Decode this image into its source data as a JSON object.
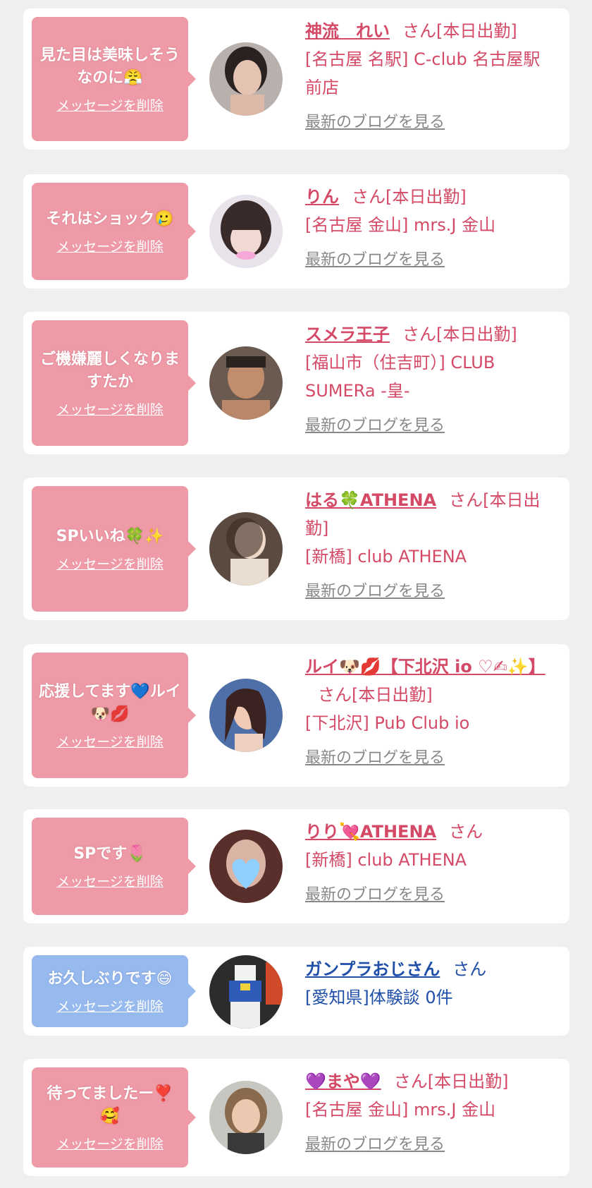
{
  "delete_label": "メッセージを削除",
  "blog_label": "最新のブログを見る",
  "colors": {
    "pink_bubble": "#ee9aa7",
    "blue_bubble": "#96b9ee",
    "pink_text": "#d44a66",
    "blue_text": "#1f4fa8",
    "link_gray": "#888888"
  },
  "entries": [
    {
      "message": "見た目は美味しそうなのに😤",
      "name": "神流　れい",
      "suffix": "さん[本日出勤]",
      "shop": "[名古屋 名駅] C-club 名古屋駅前店",
      "avatar_icon": "woman-portrait-avatar",
      "theme": "pink"
    },
    {
      "message": "それはショック🥲",
      "name": "りん",
      "suffix": "さん[本日出勤]",
      "shop": "[名古屋 金山] mrs.J 金山",
      "avatar_icon": "woman-portrait-avatar",
      "theme": "pink"
    },
    {
      "message": "ご機嫌麗しくなりますたか",
      "name": "スメラ王子",
      "suffix": "さん[本日出勤]",
      "shop": "[福山市（住吉町）] CLUB SUMERa -皇-",
      "avatar_icon": "man-portrait-avatar",
      "theme": "pink"
    },
    {
      "message": "SPいいね🍀✨",
      "name": "はる🍀ATHENA",
      "suffix": "さん[本日出勤]",
      "shop": "[新橋] club ATHENA",
      "avatar_icon": "woman-portrait-avatar",
      "theme": "pink"
    },
    {
      "message": "応援してます💙ルイ🐶💋",
      "name": "ルイ🐶💋【下北沢 io ♡✍✨】",
      "suffix": "さん[本日出勤]",
      "shop": "[下北沢] Pub Club io",
      "avatar_icon": "woman-portrait-avatar",
      "theme": "pink"
    },
    {
      "message": "SPです🌷",
      "name": "りり💘ATHENA",
      "suffix": "さん",
      "shop": "[新橋] club ATHENA",
      "avatar_icon": "woman-portrait-avatar",
      "theme": "pink"
    },
    {
      "message": "お久しぶりです😄",
      "name": "ガンプラおじさん",
      "suffix": "さん",
      "shop": "[愛知県]体験談 0件",
      "avatar_icon": "robot-figure-avatar",
      "theme": "blue"
    },
    {
      "message": "待ってましたー❣️🥰",
      "name": "💜まや💜",
      "suffix": "さん[本日出勤]",
      "shop": "[名古屋 金山] mrs.J 金山",
      "avatar_icon": "woman-portrait-avatar",
      "theme": "pink"
    }
  ]
}
